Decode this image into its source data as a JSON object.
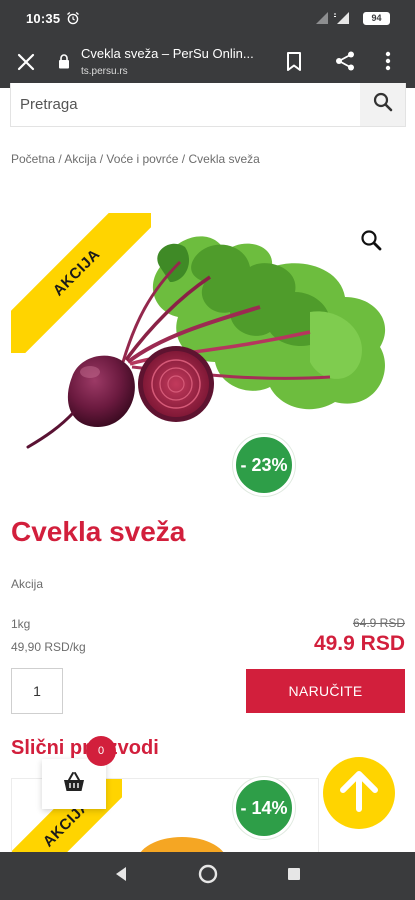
{
  "status": {
    "time": "10:35",
    "battery": "94",
    "icons": [
      "alarm-icon",
      "signal-icon",
      "wifi-icon"
    ]
  },
  "browser": {
    "tab_title": "Cvekla sveža – PerSu Onlin...",
    "url": "ts.persu.rs",
    "icons": [
      "close-icon",
      "lock-icon",
      "bookmark-icon",
      "share-icon",
      "more-vert-icon"
    ]
  },
  "search": {
    "placeholder": "Pretraga"
  },
  "breadcrumb": {
    "items": [
      "Početna",
      "Akcija",
      "Voće i povrće",
      "Cvekla sveža"
    ],
    "separator": " / "
  },
  "product": {
    "sale_ribbon": "AKCIJA",
    "discount": "- 23%",
    "name": "Cvekla sveža",
    "category": "Akcija",
    "unit": "1kg",
    "unit_price": "49,90 RSD/kg",
    "old_price": "64.9 RSD",
    "price": "49.9 RSD",
    "quantity": "1",
    "order_label": "NARUČITE"
  },
  "similar": {
    "heading": "Slični proizvodi",
    "card": {
      "sale_ribbon": "AKCIJA",
      "discount": "- 14%"
    }
  },
  "cart": {
    "count": "0"
  },
  "colors": {
    "brand_red": "#d21f3c",
    "sale_yellow": "#ffd400",
    "discount_green": "#2e9e48",
    "chrome_dark": "#3a3b3d"
  }
}
